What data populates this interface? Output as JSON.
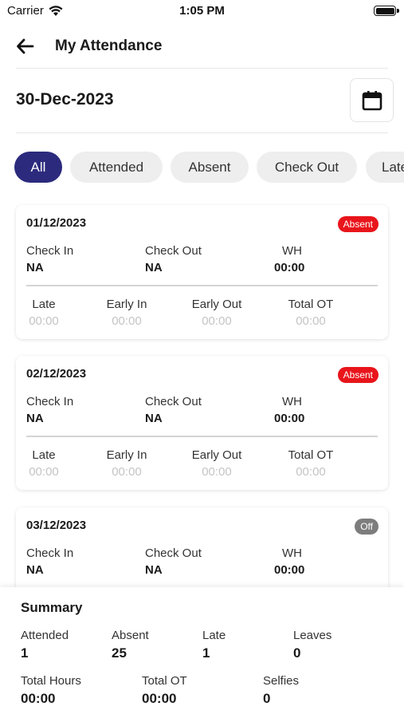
{
  "status_bar": {
    "carrier": "Carrier",
    "time": "1:05 PM"
  },
  "header": {
    "title": "My Attendance"
  },
  "date": {
    "selected": "30-Dec-2023"
  },
  "filters": [
    {
      "label": "All",
      "active": true
    },
    {
      "label": "Attended",
      "active": false
    },
    {
      "label": "Absent",
      "active": false
    },
    {
      "label": "Check Out",
      "active": false
    },
    {
      "label": "Late",
      "active": false
    }
  ],
  "labels": {
    "check_in": "Check In",
    "check_out": "Check Out",
    "wh": "WH",
    "late": "Late",
    "early_in": "Early In",
    "early_out": "Early Out",
    "total_ot": "Total OT"
  },
  "records": [
    {
      "date": "01/12/2023",
      "status": "Absent",
      "check_in": "NA",
      "check_out": "NA",
      "wh": "00:00",
      "late": "00:00",
      "early_in": "00:00",
      "early_out": "00:00",
      "total_ot": "00:00"
    },
    {
      "date": "02/12/2023",
      "status": "Absent",
      "check_in": "NA",
      "check_out": "NA",
      "wh": "00:00",
      "late": "00:00",
      "early_in": "00:00",
      "early_out": "00:00",
      "total_ot": "00:00"
    },
    {
      "date": "03/12/2023",
      "status": "Off",
      "check_in": "NA",
      "check_out": "NA",
      "wh": "00:00"
    }
  ],
  "summary": {
    "title": "Summary",
    "attended_label": "Attended",
    "attended": "1",
    "absent_label": "Absent",
    "absent": "25",
    "late_label": "Late",
    "late": "1",
    "leaves_label": "Leaves",
    "leaves": "0",
    "total_hours_label": "Total Hours",
    "total_hours": "00:00",
    "total_ot_label": "Total OT",
    "total_ot": "00:00",
    "selfies_label": "Selfies",
    "selfies": "0"
  },
  "colors": {
    "accent": "#2b2a7d",
    "absent": "#e8151b",
    "off": "#7d7d7d"
  },
  "icons": {
    "back": "arrow-left-icon",
    "calendar": "calendar-icon",
    "wifi": "wifi-icon",
    "battery": "battery-icon"
  }
}
